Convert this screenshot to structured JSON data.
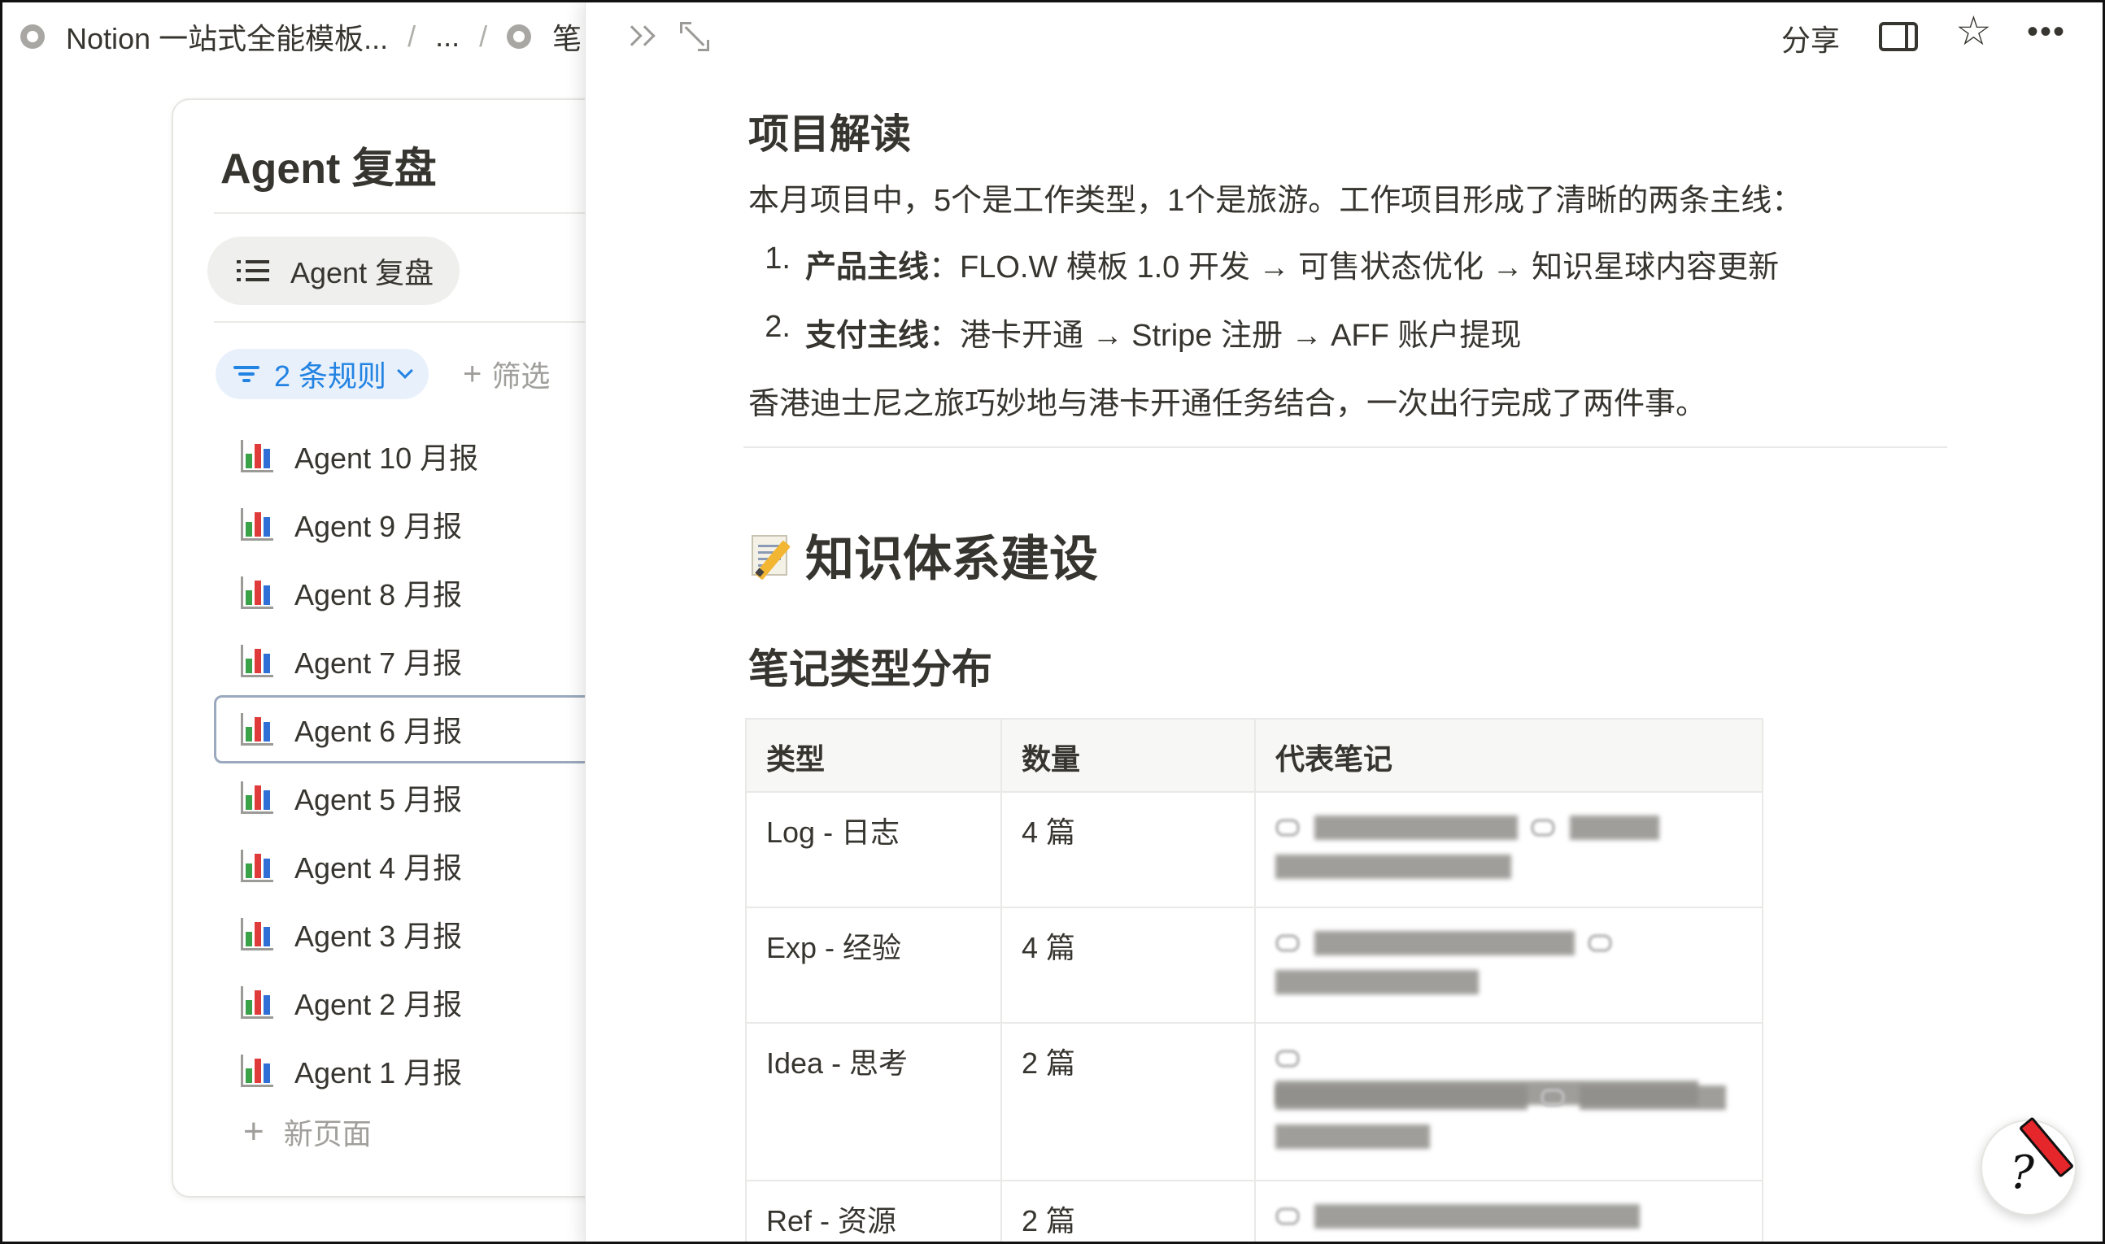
{
  "breadcrumb": {
    "workspace": "Notion 一站式全能模板...",
    "sep1": "/",
    "ellipsis": "...",
    "sep2": "/",
    "current": "笔"
  },
  "database": {
    "title": "Agent 复盘",
    "view_tab": "Agent 复盘",
    "filter_rule": "2 条规则",
    "add_filter": "筛选",
    "items": [
      {
        "label": "Agent 10 月报"
      },
      {
        "label": "Agent 9 月报"
      },
      {
        "label": "Agent 8 月报"
      },
      {
        "label": "Agent 7 月报"
      },
      {
        "label": "Agent 6 月报",
        "selected": true
      },
      {
        "label": "Agent 5 月报"
      },
      {
        "label": "Agent 4 月报"
      },
      {
        "label": "Agent 3 月报"
      },
      {
        "label": "Agent 2 月报"
      },
      {
        "label": "Agent 1 月报"
      }
    ],
    "new_page": "新页面"
  },
  "panel": {
    "topbar": {
      "share": "分享",
      "icons": [
        "double-chevron-right-icon",
        "expand-icon",
        "side-peek-icon",
        "star-icon",
        "more-icon"
      ]
    },
    "section_project": {
      "heading": "项目解读",
      "intro": "本月项目中，5个是工作类型，1个是旅游。工作项目形成了清晰的两条主线：",
      "list": [
        {
          "num": "1.",
          "bold": "产品主线",
          "text": "：FLO.W 模板 1.0 开发 → 可售状态优化 → 知识星球内容更新"
        },
        {
          "num": "2.",
          "bold": "支付主线",
          "text": "：港卡开通 → Stripe 注册 → AFF 账户提现"
        }
      ],
      "outro": "香港迪士尼之旅巧妙地与港卡开通任务结合，一次出行完成了两件事。"
    },
    "section_knowledge": {
      "heading": "知识体系建设",
      "subheading": "笔记类型分布",
      "table": {
        "headers": [
          "类型",
          "数量",
          "代表笔记"
        ],
        "rows": [
          {
            "type": "Log - 日志",
            "count": "4 篇"
          },
          {
            "type": "Exp - 经验",
            "count": "4 篇"
          },
          {
            "type": "Idea - 思考",
            "count": "2 篇"
          },
          {
            "type": "Ref - 资源",
            "count": "2 篇"
          }
        ]
      }
    }
  },
  "colors": {
    "accent_blue": "#2383e2",
    "text": "#37352f",
    "muted": "#a09f9b",
    "divider": "#e9e9e7"
  }
}
